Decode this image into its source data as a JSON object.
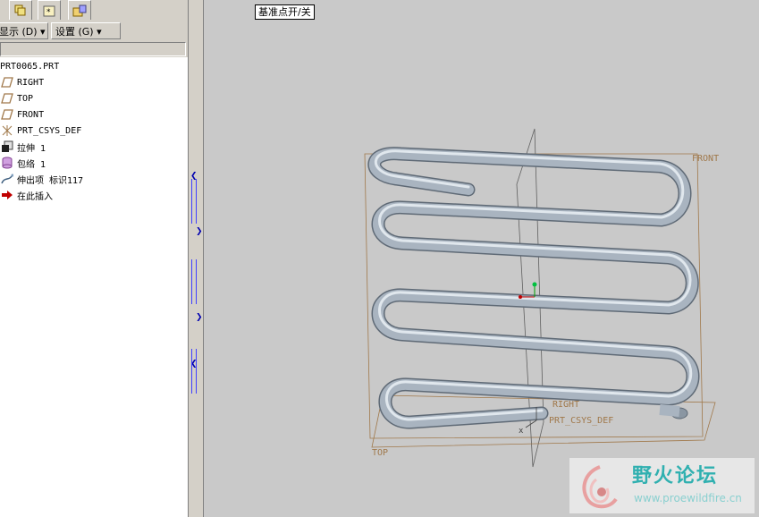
{
  "toolbar": {
    "tabs": [
      {
        "icon": "layers-icon"
      },
      {
        "icon": "star-folder-icon"
      },
      {
        "icon": "open-folder-icon"
      }
    ],
    "menus": [
      {
        "label": "显示 (D) ▾"
      },
      {
        "label": "设置 (G) ▾"
      }
    ]
  },
  "model_tree": {
    "items": [
      {
        "label": "PRT0065.PRT",
        "icon": "part-icon"
      },
      {
        "label": "RIGHT",
        "icon": "datum-plane-icon"
      },
      {
        "label": "TOP",
        "icon": "datum-plane-icon"
      },
      {
        "label": "FRONT",
        "icon": "datum-plane-icon"
      },
      {
        "label": "PRT_CSYS_DEF",
        "icon": "coordinate-system-icon"
      },
      {
        "label": "拉伸 1",
        "icon": "extrude-icon"
      },
      {
        "label": "包络 1",
        "icon": "wrap-icon"
      },
      {
        "label": "伸出项 标识117",
        "icon": "protrusion-icon"
      },
      {
        "label": "在此插入",
        "icon": "insert-here-icon"
      }
    ]
  },
  "viewport": {
    "tooltip": "基准点开/关",
    "datum_labels": {
      "front": "FRONT",
      "right": "RIGHT",
      "top": "TOP",
      "csys": "PRT_CSYS_DEF",
      "x_axis": "x"
    }
  },
  "watermark": {
    "title": "野火论坛",
    "url": "www.proewildfire.cn"
  },
  "colors": {
    "panel_bg": "#d4d0c8",
    "viewport_bg": "#c9c9c9",
    "datum_color": "#a0784a",
    "tube_color": "#a9b4c0"
  }
}
